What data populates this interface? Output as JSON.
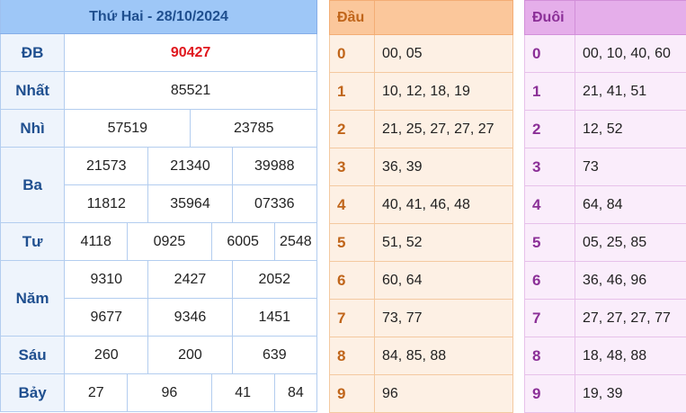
{
  "header": {
    "title": "Thứ Hai - 28/10/2024"
  },
  "prizes": {
    "db": {
      "label": "ĐB",
      "values": [
        "90427"
      ]
    },
    "nhat": {
      "label": "Nhất",
      "values": [
        "85521"
      ]
    },
    "nhi": {
      "label": "Nhì",
      "values": [
        "57519",
        "23785"
      ]
    },
    "ba": {
      "label": "Ba",
      "values": [
        "21573",
        "21340",
        "39988",
        "11812",
        "35964",
        "07336"
      ]
    },
    "tu": {
      "label": "Tư",
      "values": [
        "4118",
        "0925",
        "6005",
        "2548"
      ]
    },
    "nam": {
      "label": "Năm",
      "values": [
        "9310",
        "2427",
        "2052",
        "9677",
        "9346",
        "1451"
      ]
    },
    "sau": {
      "label": "Sáu",
      "values": [
        "260",
        "200",
        "639"
      ]
    },
    "bay": {
      "label": "Bảy",
      "values": [
        "27",
        "96",
        "41",
        "84"
      ]
    }
  },
  "dau": {
    "header": "Đầu",
    "rows": [
      {
        "key": "0",
        "value": "00, 05"
      },
      {
        "key": "1",
        "value": "10, 12, 18, 19"
      },
      {
        "key": "2",
        "value": "21, 25, 27, 27, 27"
      },
      {
        "key": "3",
        "value": "36, 39"
      },
      {
        "key": "4",
        "value": "40, 41, 46, 48"
      },
      {
        "key": "5",
        "value": "51, 52"
      },
      {
        "key": "6",
        "value": "60, 64"
      },
      {
        "key": "7",
        "value": "73, 77"
      },
      {
        "key": "8",
        "value": "84, 85, 88"
      },
      {
        "key": "9",
        "value": "96"
      }
    ]
  },
  "duoi": {
    "header": "Đuôi",
    "rows": [
      {
        "key": "0",
        "value": "00, 10, 40, 60"
      },
      {
        "key": "1",
        "value": "21, 41, 51"
      },
      {
        "key": "2",
        "value": "12, 52"
      },
      {
        "key": "3",
        "value": "73"
      },
      {
        "key": "4",
        "value": "64, 84"
      },
      {
        "key": "5",
        "value": "05, 25, 85"
      },
      {
        "key": "6",
        "value": "36, 46, 96"
      },
      {
        "key": "7",
        "value": "27, 27, 27, 77"
      },
      {
        "key": "8",
        "value": "18, 48, 88"
      },
      {
        "key": "9",
        "value": "19, 39"
      }
    ]
  },
  "colors": {
    "header_blue": "#9ec7f7",
    "special_red": "#e0181e",
    "dau_orange": "#fbc79b",
    "duoi_purple": "#e5aeea"
  }
}
